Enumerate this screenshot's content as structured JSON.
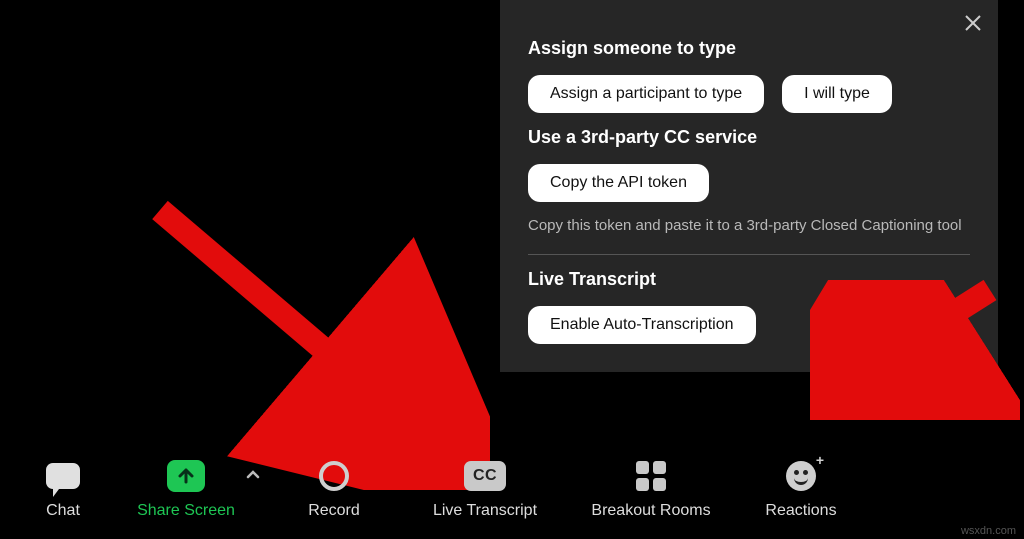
{
  "popup": {
    "section1_title": "Assign someone to type",
    "assign_btn": "Assign a participant to type",
    "self_btn": "I will type",
    "section2_title": "Use a 3rd-party CC service",
    "copy_btn": "Copy the API token",
    "copy_helper": "Copy this token and paste it to a 3rd-party Closed Captioning tool",
    "section3_title": "Live Transcript",
    "enable_btn": "Enable Auto-Transcription"
  },
  "toolbar": {
    "chat": "Chat",
    "share": "Share Screen",
    "record": "Record",
    "cc": "Live Transcript",
    "cc_badge": "CC",
    "breakout": "Breakout Rooms",
    "reactions": "Reactions"
  },
  "watermark": "wsxdn.com"
}
